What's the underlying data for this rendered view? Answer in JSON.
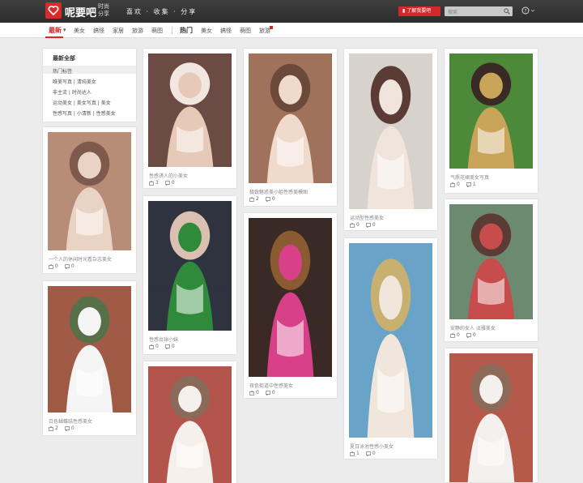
{
  "header": {
    "logo_text": "呢要吧",
    "logo_sub": [
      "时尚",
      "分享"
    ],
    "slogan": "喜欢 · 收集 · 分享",
    "cta": "了解我要吧",
    "search_placeholder": "搜索"
  },
  "nav": {
    "items": [
      {
        "label": "最新",
        "style": "active"
      },
      {
        "label": "美女"
      },
      {
        "label": "搞怪"
      },
      {
        "label": "家居"
      },
      {
        "label": "旅游"
      },
      {
        "label": "萌图"
      },
      {
        "label": "热门",
        "style": "hot"
      },
      {
        "label": "美女"
      },
      {
        "label": "搞怪"
      },
      {
        "label": "萌图"
      },
      {
        "label": "旅游"
      }
    ]
  },
  "categories": {
    "title": "最新全部",
    "hot": "热门标签",
    "rows": [
      [
        "唯美写真",
        "清纯美女"
      ],
      [
        "非主流",
        "时尚达人"
      ],
      [
        "运动美女",
        "美女写真",
        "美女"
      ],
      [
        "性感写真",
        "小清新",
        "性感美女"
      ]
    ]
  },
  "cards": [
    {
      "caption": "一个人的休闲时光看杂志美女",
      "likes": "0",
      "comments": "0",
      "colors": [
        "#b78d78",
        "#e9d3c4",
        "#7d5a4b"
      ]
    },
    {
      "caption": "白色蝴蝶结性感美女",
      "likes": "2",
      "comments": "0",
      "colors": [
        "#a05a45",
        "#f5f5f5",
        "#57704a"
      ]
    },
    {
      "caption": "性感诱人的小美女",
      "likes": "3",
      "comments": "0",
      "colors": [
        "#6b4b43",
        "#e7c9b8",
        "#f2e7e0"
      ]
    },
    {
      "caption": "性感台球小妹",
      "likes": "0",
      "comments": "0",
      "colors": [
        "#2f3340",
        "#2f8a3c",
        "#d9c0b0"
      ]
    },
    {
      "caption": "",
      "likes": "",
      "comments": "",
      "colors": [
        "#b4554d",
        "#f5f0ec",
        "#8a6a58"
      ]
    },
    {
      "caption": "极致魅惑美小姐性感美模图",
      "likes": "2",
      "comments": "0",
      "colors": [
        "#a0725c",
        "#f0dacb",
        "#6b4a3c"
      ]
    },
    {
      "caption": "夜色街道中性感美女",
      "likes": "0",
      "comments": "0",
      "colors": [
        "#3a2a25",
        "#d9408a",
        "#8a5a30"
      ]
    },
    {
      "caption": "运动型性感美女",
      "likes": "0",
      "comments": "0",
      "colors": [
        "#d8d2cc",
        "#f0e4dc",
        "#5a3c34"
      ]
    },
    {
      "caption": "夏日泳池性感小美女",
      "likes": "1",
      "comments": "0",
      "colors": [
        "#6aa3c8",
        "#f1e6dc",
        "#c8b070"
      ]
    },
    {
      "caption": "气质花裙美女写真",
      "likes": "0",
      "comments": "1",
      "colors": [
        "#4c8a3a",
        "#c9a55a",
        "#3a2a25"
      ]
    },
    {
      "caption": "安静的女人 淡雅美女",
      "likes": "0",
      "comments": "0",
      "colors": [
        "#6c8a70",
        "#c74d4d",
        "#5a3c34"
      ]
    },
    {
      "caption": "",
      "likes": "",
      "comments": "",
      "colors": [
        "#b55a4a",
        "#f4f0ee",
        "#8d6a58"
      ]
    }
  ]
}
